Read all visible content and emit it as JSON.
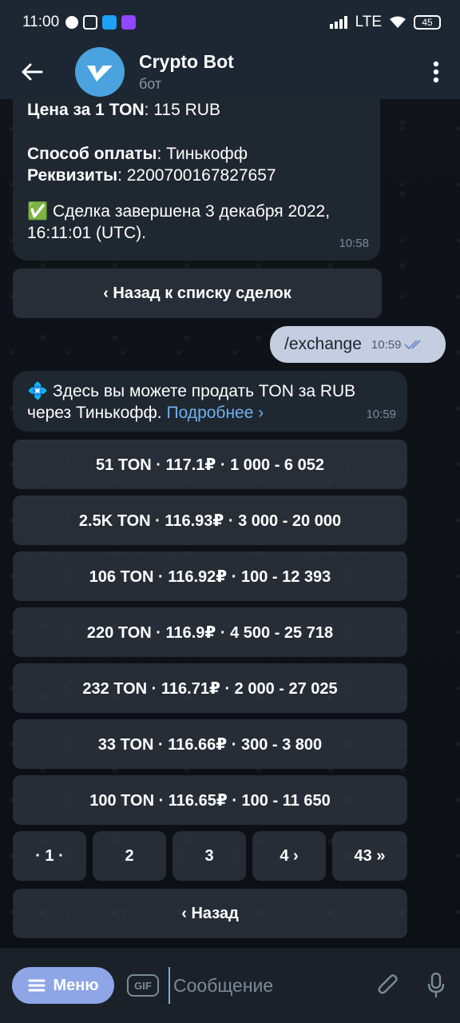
{
  "status": {
    "time": "11:00",
    "network": "LTE",
    "battery": "45"
  },
  "header": {
    "title": "Crypto Bot",
    "subtitle": "бот"
  },
  "messages": {
    "deal": {
      "price_label": "Цена за 1 TON",
      "price_value": ": 115 RUB",
      "pay_label": "Способ оплаты",
      "pay_value": ": Тинькофф",
      "req_label": "Реквизиты",
      "req_value": ": 2200700167827657",
      "done_icon": "✅",
      "done_text": "Сделка завершена 3 декабря 2022, 16:11:01 (UTC).",
      "time": "10:58",
      "back_button": "‹ Назад к списку сделок"
    },
    "outgoing": {
      "text": "/exchange",
      "time": "10:59"
    },
    "offer": {
      "icon": "💠",
      "text": "Здесь вы можете продать TON за RUB через Тинькофф.",
      "link": "Подробнее ›",
      "time": "10:59"
    }
  },
  "offers": [
    "51 TON · 117.1₽ · 1 000 - 6 052",
    "2.5K TON · 116.93₽ · 3 000 - 20 000",
    "106 TON · 116.92₽ · 100 - 12 393",
    "220 TON · 116.9₽ · 4 500 - 25 718",
    "232 TON · 116.71₽ · 2 000 - 27 025",
    "33 TON · 116.66₽ · 300 - 3 800",
    "100 TON · 116.65₽ · 100 - 11 650"
  ],
  "pagination": [
    "· 1 ·",
    "2",
    "3",
    "4 ›",
    "43 »"
  ],
  "back_label": "‹ Назад",
  "bottom": {
    "menu_label": "Меню",
    "gif_label": "GIF",
    "input_placeholder": "Сообщение"
  },
  "colors": {
    "accent": "#6fb0f0",
    "menu": "#8ea5e6",
    "bubble_in": "#1f2731",
    "bubble_out": "#c5cee0"
  },
  "icons": [
    "back-arrow-icon",
    "bot-logo-icon",
    "more-vert-icon",
    "menu-icon",
    "attach-icon",
    "mic-icon",
    "double-check-icon"
  ]
}
